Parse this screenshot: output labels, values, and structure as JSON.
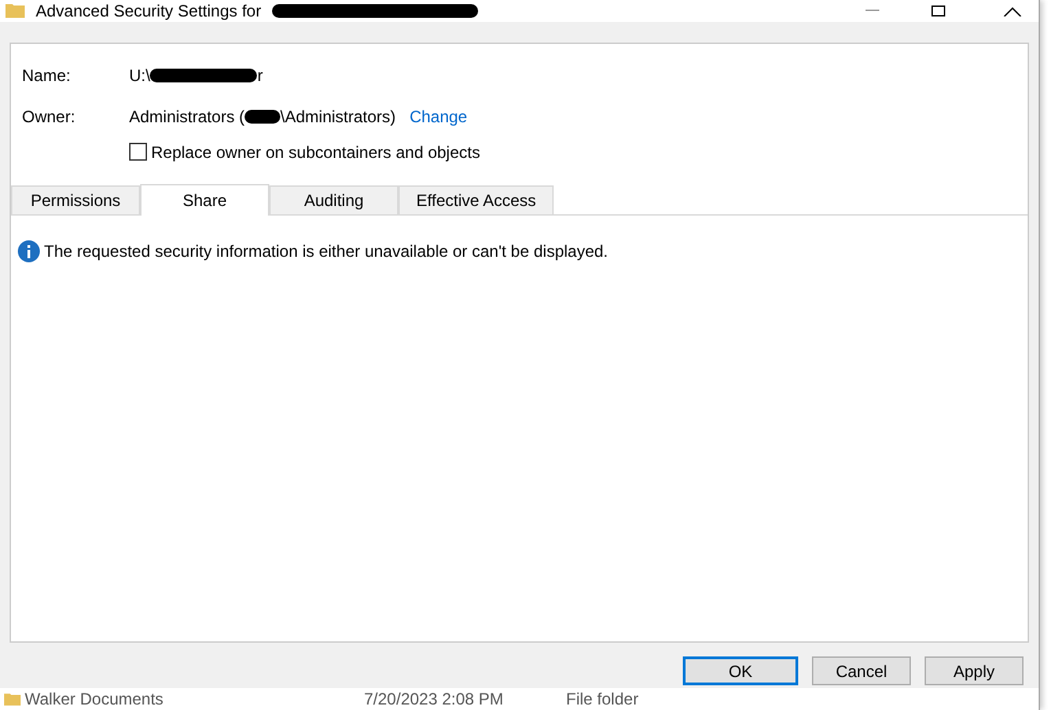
{
  "window": {
    "title": "Advanced Security Settings for"
  },
  "name": {
    "label": "Name:",
    "value_start": "U:\\",
    "value_end": "r"
  },
  "owner": {
    "label": "Owner:",
    "value_start": "Administrators (",
    "value_end": "\\Administrators)",
    "link": "Change"
  },
  "replace_owner": {
    "label": "Replace owner on subcontainers and objects",
    "checked": false
  },
  "tabs": [
    {
      "label": "Permissions",
      "selected": false
    },
    {
      "label": "Share",
      "selected": true
    },
    {
      "label": "Auditing",
      "selected": false
    },
    {
      "label": "Effective Access",
      "selected": false
    }
  ],
  "message": "The requested security information is either unavailable or can't be displayed.",
  "buttons": [
    {
      "label": "OK",
      "default": true
    },
    {
      "label": "Cancel",
      "default": false
    },
    {
      "label": "Apply",
      "default": false
    }
  ],
  "background_row": {
    "name": "Walker Documents",
    "date": "7/20/2023 2:08 PM",
    "type": "File folder"
  }
}
